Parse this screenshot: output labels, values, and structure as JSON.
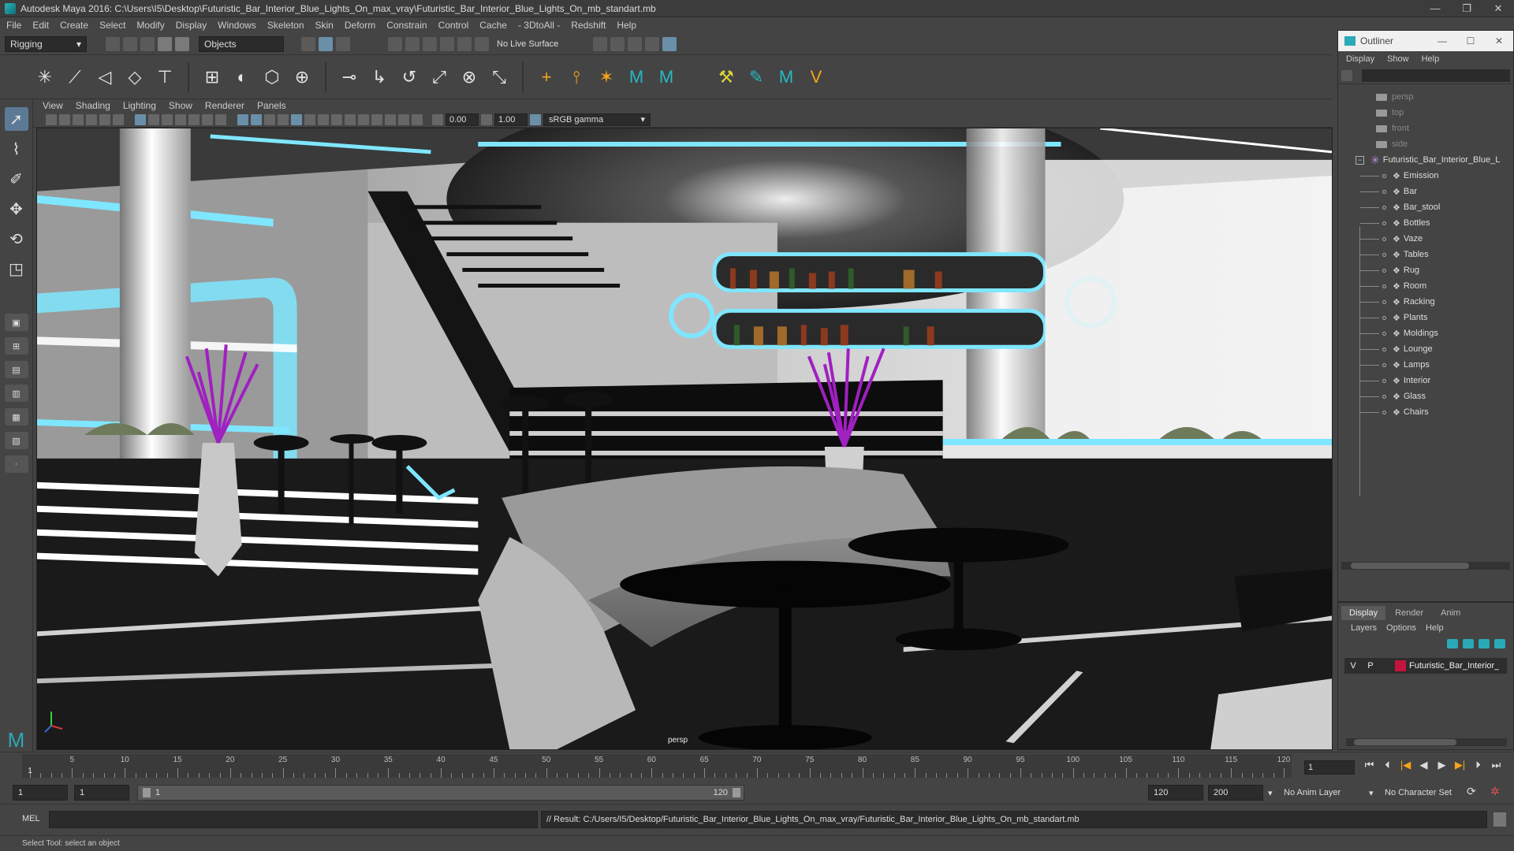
{
  "window": {
    "title": "Autodesk Maya 2016: C:\\Users\\I5\\Desktop\\Futuristic_Bar_Interior_Blue_Lights_On_max_vray\\Futuristic_Bar_Interior_Blue_Lights_On_mb_standart.mb",
    "min": "—",
    "max": "❐",
    "close": "✕"
  },
  "menubar": [
    "File",
    "Edit",
    "Create",
    "Select",
    "Modify",
    "Display",
    "Windows",
    "Skeleton",
    "Skin",
    "Deform",
    "Constrain",
    "Control",
    "Cache",
    "- 3DtoAll -",
    "Redshift",
    "Help"
  ],
  "statusline": {
    "mode": "Rigging",
    "selection_mask": "Objects",
    "live_surface": "No Live Surface"
  },
  "panel": {
    "menu": [
      "View",
      "Shading",
      "Lighting",
      "Show",
      "Renderer",
      "Panels"
    ],
    "exposure": "0.00",
    "gamma": "1.00",
    "color_space": "sRGB gamma",
    "camera_label": "persp"
  },
  "outliner": {
    "title": "Outliner",
    "menu": [
      "Display",
      "Show",
      "Help"
    ],
    "cameras": [
      "persp",
      "top",
      "front",
      "side"
    ],
    "root": "Futuristic_Bar_Interior_Blue_L",
    "children": [
      "Emission",
      "Bar",
      "Bar_stool",
      "Bottles",
      "Vaze",
      "Tables",
      "Rug",
      "Room",
      "Racking",
      "Plants",
      "Moldings",
      "Lounge",
      "Lamps",
      "Interior",
      "Glass",
      "Chairs"
    ]
  },
  "layers": {
    "tabs": [
      "Display",
      "Render",
      "Anim"
    ],
    "active_tab": "Display",
    "menu": [
      "Layers",
      "Options",
      "Help"
    ],
    "row": {
      "v": "V",
      "p": "P",
      "name": "Futuristic_Bar_Interior_",
      "color": "#c2143d"
    }
  },
  "timeline": {
    "start": 1,
    "end": 120,
    "labels": [
      "5",
      "10",
      "15",
      "20",
      "25",
      "30",
      "35",
      "40",
      "45",
      "50",
      "55",
      "60",
      "65",
      "70",
      "75",
      "80",
      "85",
      "90",
      "95",
      "100",
      "105",
      "110",
      "115",
      "120"
    ],
    "playhead_label": "1",
    "current_frame": "1"
  },
  "range": {
    "start_frame": "1",
    "playback_start": "1",
    "slider_start": "1",
    "slider_end": "120",
    "playback_end": "120",
    "end_frame": "200",
    "anim_layer": "No Anim Layer",
    "char_set": "No Character Set"
  },
  "cmdline": {
    "lang": "MEL",
    "result": "// Result: C:/Users/I5/Desktop/Futuristic_Bar_Interior_Blue_Lights_On_max_vray/Futuristic_Bar_Interior_Blue_Lights_On_mb_standart.mb"
  },
  "helpline": "Select Tool: select an object",
  "colors": {
    "accent": "#2aa9b6",
    "glow": "#7fe6ff",
    "purple": "#a020c0"
  }
}
